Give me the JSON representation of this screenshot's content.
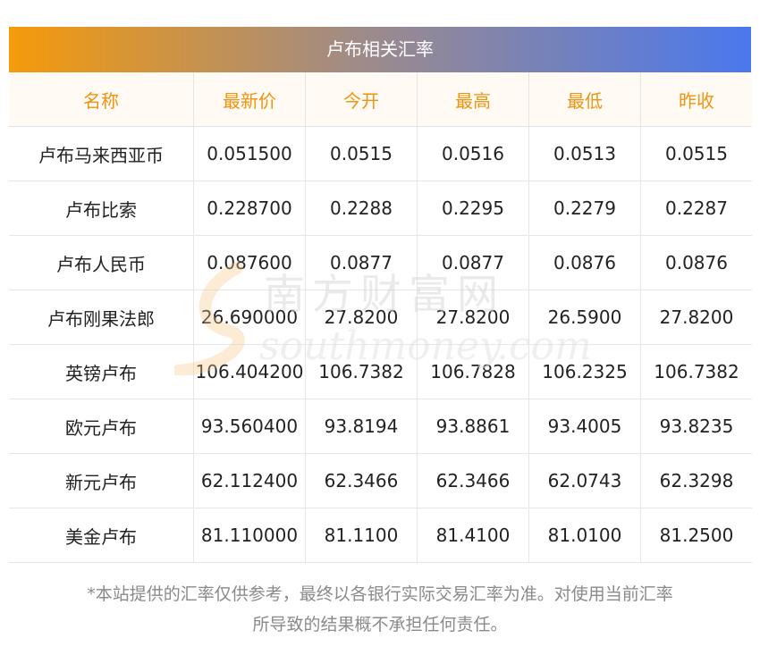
{
  "banner_title": "卢布相关汇率",
  "columns": [
    "名称",
    "最新价",
    "今开",
    "最高",
    "最低",
    "昨收"
  ],
  "rows": [
    [
      "卢布马来西亚币",
      "0.051500",
      "0.0515",
      "0.0516",
      "0.0513",
      "0.0515"
    ],
    [
      "卢布比索",
      "0.228700",
      "0.2288",
      "0.2295",
      "0.2279",
      "0.2287"
    ],
    [
      "卢布人民币",
      "0.087600",
      "0.0877",
      "0.0877",
      "0.0876",
      "0.0876"
    ],
    [
      "卢布刚果法郎",
      "26.690000",
      "27.8200",
      "27.8200",
      "26.5900",
      "27.8200"
    ],
    [
      "英镑卢布",
      "106.404200",
      "106.7382",
      "106.7828",
      "106.2325",
      "106.7382"
    ],
    [
      "欧元卢布",
      "93.560400",
      "93.8194",
      "93.8861",
      "93.4005",
      "93.8235"
    ],
    [
      "新元卢布",
      "62.112400",
      "62.3466",
      "62.3466",
      "62.0743",
      "62.3298"
    ],
    [
      "美金卢布",
      "81.110000",
      "81.1100",
      "81.4100",
      "81.0100",
      "81.2500"
    ]
  ],
  "note_line1": "*本站提供的汇率仅供参考，最终以各银行实际交易汇率为准。对使用当前汇率",
  "note_line2": "所导致的结果概不承担任何责任。",
  "watermark": {
    "cn": "南方财富网",
    "en": "southmoney.com"
  },
  "colors": {
    "accent": "#f0930f",
    "gradient_start": "#f59a0b",
    "gradient_end": "#4a78ee"
  }
}
